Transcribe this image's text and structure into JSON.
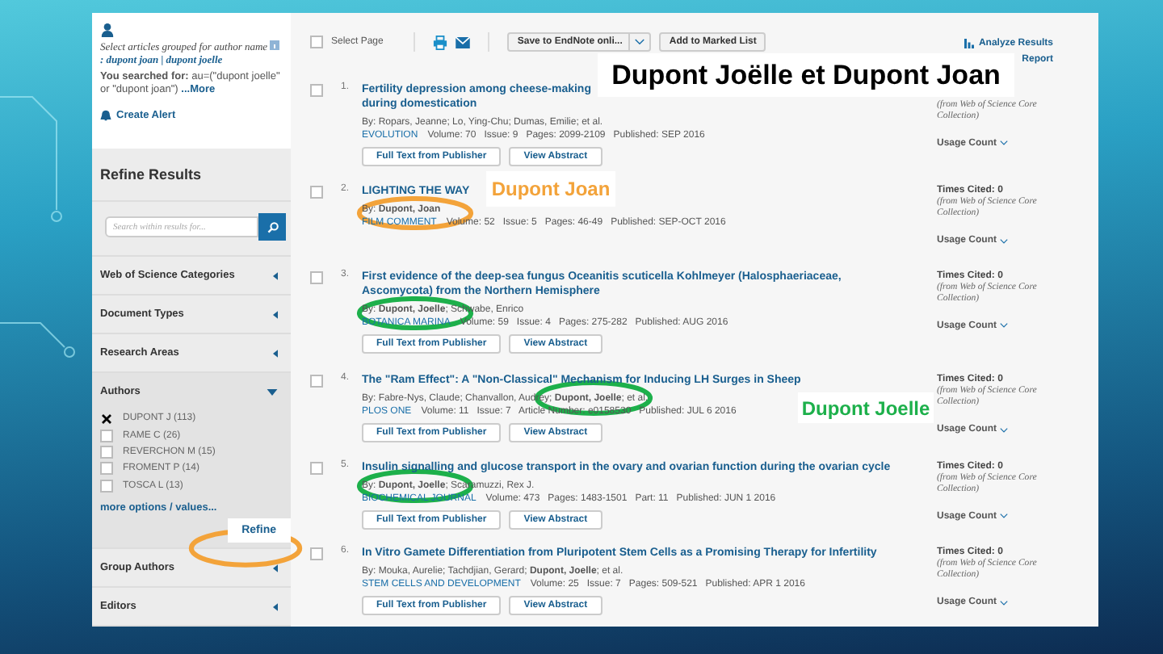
{
  "sidebar": {
    "grouped_note": "Select articles grouped for author name",
    "grouped_names": ": dupont joan | dupont joelle",
    "searched_text": "**You searched for:** au=(\"dupont joelle\" or \"dupont joan\")",
    "more_link": "...More",
    "create_alert": "Create Alert",
    "refine_title": "Refine Results",
    "search_placeholder": "Search within results for...",
    "facets": [
      {
        "label": "Web of Science Categories",
        "expanded": false
      },
      {
        "label": "Document Types",
        "expanded": false
      },
      {
        "label": "Research Areas",
        "expanded": false
      },
      {
        "label": "Authors",
        "expanded": true,
        "options": [
          {
            "label": "DUPONT J (113)",
            "checked": true
          },
          {
            "label": "RAME C (26)",
            "checked": false
          },
          {
            "label": "REVERCHON M (15)",
            "checked": false
          },
          {
            "label": "FROMENT P (14)",
            "checked": false
          },
          {
            "label": "TOSCA L (13)",
            "checked": false
          }
        ],
        "more_options": "more options / values...",
        "refine_button": "Refine"
      },
      {
        "label": "Group Authors",
        "expanded": false
      },
      {
        "label": "Editors",
        "expanded": false
      }
    ]
  },
  "toolbar": {
    "select_page": {
      "label": "Select Page",
      "checked": false
    },
    "save_dropdown": "Save to EndNote onli...",
    "add_button": "Add to Marked List",
    "analyze_link": "Analyze Results",
    "report_link": "Report"
  },
  "results": [
    {
      "number": "1.",
      "checked": false,
      "title": "Fertility depression among cheese-making",
      "title_2": "during domestication",
      "authors": "By: Ropars, Jeanne; Lo, Ying-Chu; Dumas, Emilie; et al.",
      "journal": "EVOLUTION",
      "details": "Volume: 70   Issue: 9   Pages: 2099-2109   Published: SEP 2016",
      "buttons": [
        "Full Text from Publisher",
        "View Abstract"
      ],
      "cited_note": "(from Web of Science Core Collection)",
      "usage": "Usage Count"
    },
    {
      "number": "2.",
      "checked": false,
      "title": "LIGHTING THE WAY",
      "authors": "By: **Dupont, Joan**",
      "journal": "FILM COMMENT",
      "details": "Volume: 52   Issue: 5   Pages: 46-49   Published: SEP-OCT 2016",
      "times_cited": "Times Cited: 0",
      "cited_note": "(from Web of Science Core Collection)",
      "usage": "Usage Count"
    },
    {
      "number": "3.",
      "checked": false,
      "title": "First evidence of the deep-sea fungus Oceanitis scuticella Kohlmeyer (Halosphaeriaceae,",
      "title_2": "Ascomycota) from the Northern Hemisphere",
      "authors": "By: **Dupont, Joelle**; Schwabe, Enrico",
      "journal": "BOTANICA MARINA",
      "details": "Volume: 59   Issue: 4   Pages: 275-282   Published: AUG 2016",
      "buttons": [
        "Full Text from Publisher",
        "View Abstract"
      ],
      "times_cited": "Times Cited: 0",
      "cited_note": "(from Web of Science Core Collection)",
      "usage": "Usage Count"
    },
    {
      "number": "4.",
      "checked": false,
      "title": "The \"Ram Effect\": A \"Non-Classical\" Mechanism for Inducing LH Surges in Sheep",
      "authors": "By: Fabre-Nys, Claude; Chanvallon, Audrey; **Dupont, Joelle**; et al.",
      "journal": "PLOS ONE",
      "details": "Volume: 11   Issue: 7   Article Number: e0158530   Published: JUL 6 2016",
      "buttons": [
        "Full Text from Publisher",
        "View Abstract"
      ],
      "times_cited": "Times Cited: 0",
      "cited_note": "(from Web of Science Core Collection)",
      "usage": "Usage Count"
    },
    {
      "number": "5.",
      "checked": false,
      "title": "Insulin signalling and glucose transport in the ovary and ovarian function during the ovarian cycle",
      "authors": "By: **Dupont, Joelle**; Scaramuzzi, Rex J.",
      "journal": "BIOCHEMICAL JOURNAL",
      "details": "Volume: 473   Pages: 1483-1501   Part: 11   Published: JUN 1 2016",
      "buttons": [
        "Full Text from Publisher",
        "View Abstract"
      ],
      "times_cited": "Times Cited: 0",
      "cited_note": "(from Web of Science Core Collection)",
      "usage": "Usage Count"
    },
    {
      "number": "6.",
      "checked": false,
      "title": "In Vitro Gamete Differentiation from Pluripotent Stem Cells as a Promising Therapy for Infertility",
      "authors": "By: Mouka, Aurelie; Tachdjian, Gerard; **Dupont, Joelle**; et al.",
      "journal": "STEM CELLS AND DEVELOPMENT",
      "details": "Volume: 25   Issue: 7   Pages: 509-521   Published: APR 1 2016",
      "buttons": [
        "Full Text from Publisher",
        "View Abstract"
      ],
      "times_cited": "Times Cited: 0",
      "cited_note": "(from Web of Science Core Collection)",
      "usage": "Usage Count"
    }
  ],
  "annotations": [
    {
      "kind": "label",
      "text": "Dupont Joëlle et Dupont Joan",
      "color": "#000000"
    },
    {
      "kind": "label",
      "text": "Dupont Joan",
      "color": "#f3a33a"
    },
    {
      "kind": "label",
      "text": "Dupont Joelle",
      "color": "#1db04b"
    },
    {
      "kind": "oval",
      "color": "#f3a33a"
    },
    {
      "kind": "oval",
      "color": "#f3a33a"
    },
    {
      "kind": "oval",
      "color": "#1db04b"
    },
    {
      "kind": "oval",
      "color": "#1db04b"
    },
    {
      "kind": "oval",
      "color": "#1db04b"
    }
  ]
}
